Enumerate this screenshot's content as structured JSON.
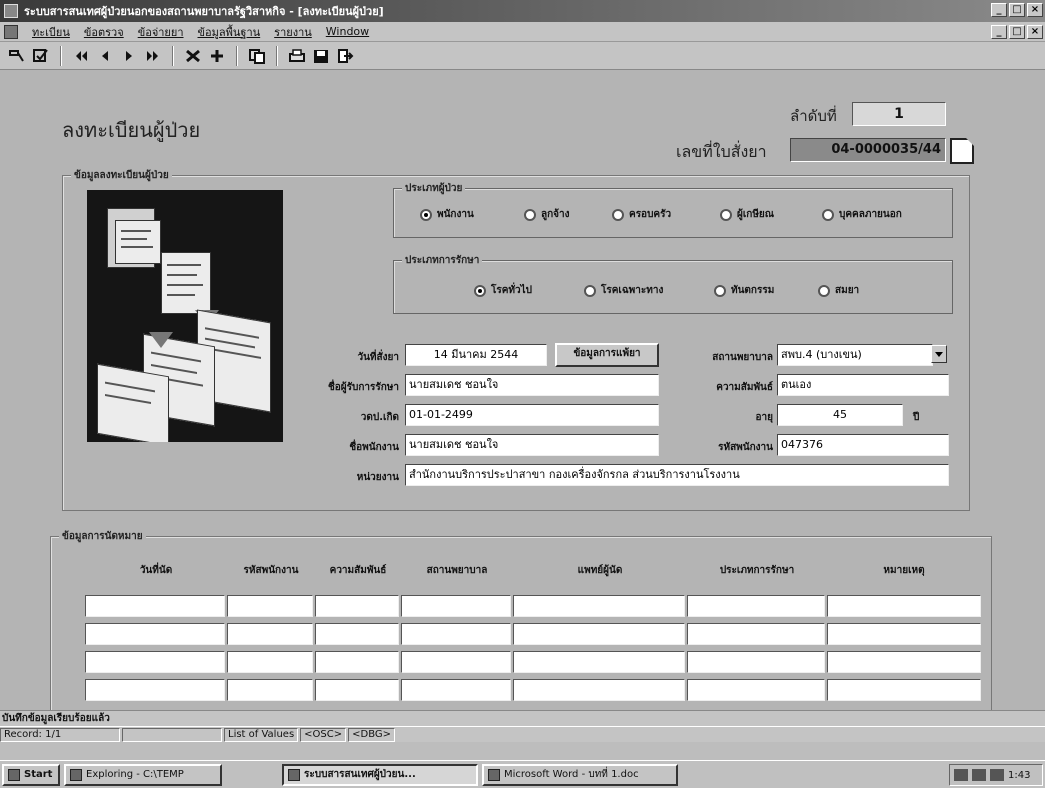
{
  "window": {
    "title": "ระบบสารสนเทศผู้ป่วยนอกของสถานพยาบาลรัฐวิสาหกิจ - [ลงทะเบียนผู้ป่วย]",
    "controls": [
      "_",
      "□",
      "×"
    ]
  },
  "menu": {
    "items": [
      "ทะเบียน",
      "ข้อตรวจ",
      "ข้อจ่ายยา",
      "ข้อมูลพื้นฐาน",
      "รายงาน",
      "Window"
    ]
  },
  "form": {
    "title": "ลงทะเบียนผู้ป่วย",
    "seq_label": "ลำดับที่",
    "seq_value": "1",
    "order_label": "เลขที่ใบสั่งยา",
    "order_value": "04-0000035/44"
  },
  "patient": {
    "group_title": "ข้อมูลลงทะเบียนผู้ป่วย",
    "type_title": "ประเภทผู้ป่วย",
    "types": [
      {
        "label": "พนักงาน",
        "checked": true
      },
      {
        "label": "ลูกจ้าง",
        "checked": false
      },
      {
        "label": "ครอบครัว",
        "checked": false
      },
      {
        "label": "ผู้เกษียณ",
        "checked": false
      },
      {
        "label": "บุคคลภายนอก",
        "checked": false
      }
    ],
    "treat_title": "ประเภทการรักษา",
    "treatments": [
      {
        "label": "โรคทั่วไป",
        "checked": true
      },
      {
        "label": "โรคเฉพาะทาง",
        "checked": false
      },
      {
        "label": "ทันตกรรม",
        "checked": false
      },
      {
        "label": "สมยา",
        "checked": false
      }
    ],
    "fields": {
      "date_label": "วันที่สั่งยา",
      "date_value": "14 มีนาคม 2544",
      "more_button": "ข้อมูลการแพ้ยา",
      "hospital_label": "สถานพยาบาล",
      "hospital_value": "สพบ.4 (บางเขน)",
      "receiver_label": "ชื่อผู้รับการรักษา",
      "receiver_value": "นายสมเดช ชอนใจ",
      "relation_label": "ความสัมพันธ์",
      "relation_value": "ตนเอง",
      "dob_label": "วดป.เกิด",
      "dob_value": "01-01-2499",
      "age_label": "อายุ",
      "age_value": "45",
      "age_unit": "ปี",
      "employee_label": "ชื่อพนักงาน",
      "employee_value": "นายสมเดช ชอนใจ",
      "emp_code_label": "รหัสพนักงาน",
      "emp_code_value": "047376",
      "unit_label": "หน่วยงาน",
      "unit_value": "สำนักงานบริการประปาสาขา กองเครื่องจักรกล ส่วนบริการงานโรงงาน"
    }
  },
  "appointment": {
    "group_title": "ข้อมูลการนัดหมาย",
    "columns": [
      "วันที่นัด",
      "รหัสพนักงาน",
      "ความสัมพันธ์",
      "สถานพยาบาล",
      "แพทย์ผู้นัด",
      "ประเภทการรักษา",
      "หมายเหตุ"
    ]
  },
  "status": {
    "message": "บันทึกข้อมูลเรียบร้อยแล้ว",
    "record": "Record: 1/1",
    "lov": "List of Values",
    "osc": "<OSC>",
    "dbg": "<DBG>"
  },
  "taskbar": {
    "start": "Start",
    "items": [
      "Exploring - C:\\TEMP",
      "ระบบสารสนเทศผู้ป่วยน...",
      "Microsoft Word - บทที่ 1.doc"
    ],
    "clock": "1:43"
  }
}
